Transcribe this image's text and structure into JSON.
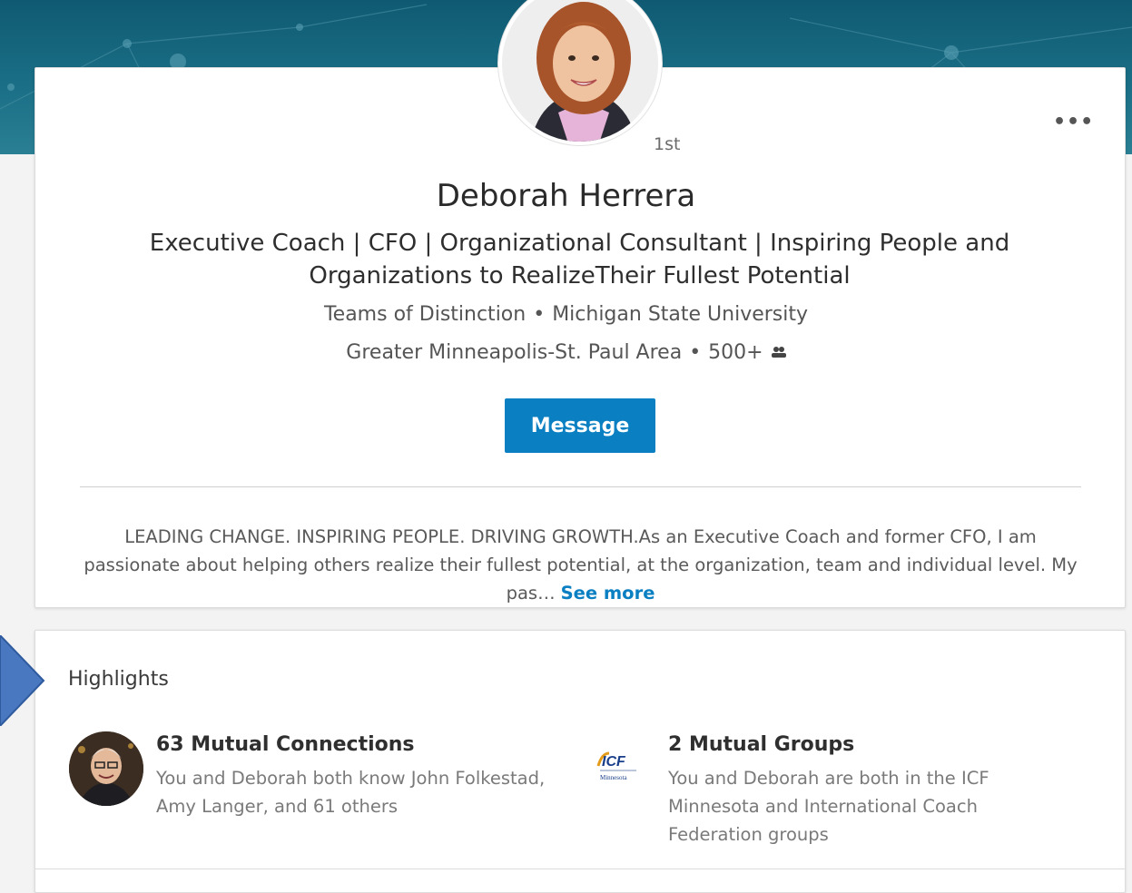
{
  "profile": {
    "degree": "1st",
    "more_label": "•••",
    "name": "Deborah Herrera",
    "headline": "Executive Coach | CFO | Organizational Consultant | Inspiring People and Organizations to RealizeTheir Fullest Potential",
    "company": "Teams of Distinction",
    "school": "Michigan State University",
    "location": "Greater Minneapolis-St. Paul Area",
    "connections": "500+",
    "message_label": "Message",
    "summary": "LEADING CHANGE. INSPIRING PEOPLE. DRIVING GROWTH.As an Executive Coach and former CFO, I am passionate about helping others realize their fullest potential, at the organization, team and individual level. My pas…",
    "see_more_label": "See more"
  },
  "highlights": {
    "title": "Highlights",
    "mutual_connections": {
      "title": "63 Mutual Connections",
      "description": "You and Deborah both know John Folkestad, Amy Langer, and 61 others"
    },
    "mutual_groups": {
      "title": "2 Mutual Groups",
      "description": "You and Deborah are both in the ICF Minnesota and International Coach Federation groups",
      "logo_text": "ICF",
      "logo_subtext": "Minnesota"
    }
  },
  "colors": {
    "accent": "#0a7fc2",
    "banner": "#1a6f86"
  }
}
